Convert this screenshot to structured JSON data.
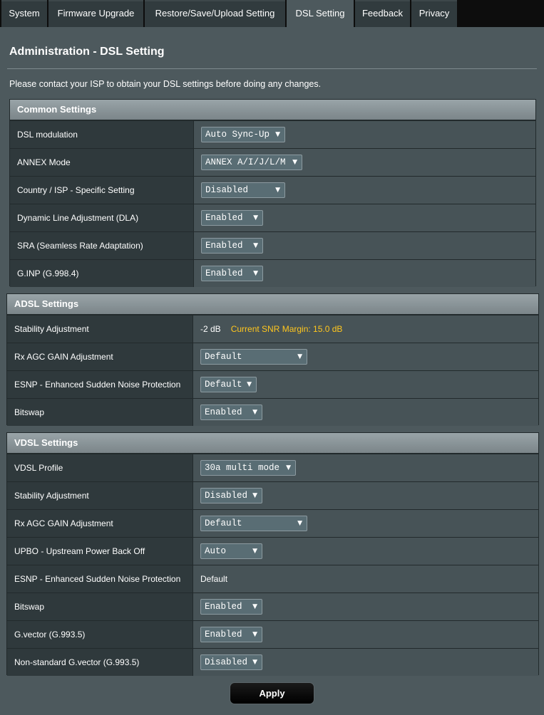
{
  "tabs": [
    "System",
    "Firmware Upgrade",
    "Restore/Save/Upload Setting",
    "DSL Setting",
    "Feedback",
    "Privacy"
  ],
  "active_tab": "DSL Setting",
  "page_title": "Administration - DSL Setting",
  "notice": "Please contact your ISP to obtain your DSL settings before doing any changes.",
  "common": {
    "title": "Common Settings",
    "rows": [
      {
        "label": "DSL modulation",
        "value": "Auto Sync-Up"
      },
      {
        "label": "ANNEX Mode",
        "value": "ANNEX A/I/J/L/M"
      },
      {
        "label": "Country / ISP - Specific Setting",
        "value": "Disabled"
      },
      {
        "label": "Dynamic Line Adjustment (DLA)",
        "value": "Enabled"
      },
      {
        "label": "SRA (Seamless Rate Adaptation)",
        "value": "Enabled"
      },
      {
        "label": "G.INP (G.998.4)",
        "value": "Enabled"
      }
    ]
  },
  "adsl": {
    "title": "ADSL Settings",
    "stability_label": "Stability Adjustment",
    "stability_value": "-2 dB",
    "snr_text": "Current SNR Margin: 15.0 dB",
    "rows": [
      {
        "label": "Rx AGC GAIN Adjustment",
        "value": "Default"
      },
      {
        "label": "ESNP - Enhanced Sudden Noise Protection",
        "value": "Default"
      },
      {
        "label": "Bitswap",
        "value": "Enabled"
      }
    ]
  },
  "vdsl": {
    "title": "VDSL Settings",
    "rows": [
      {
        "label": "VDSL Profile",
        "value": "30a multi mode"
      },
      {
        "label": "Stability Adjustment",
        "value": "Disabled"
      },
      {
        "label": "Rx AGC GAIN Adjustment",
        "value": "Default"
      },
      {
        "label": "UPBO - Upstream Power Back Off",
        "value": "Auto"
      }
    ],
    "esnp_label": "ESNP - Enhanced Sudden Noise Protection",
    "esnp_value": "Default",
    "rows2": [
      {
        "label": "Bitswap",
        "value": "Enabled"
      },
      {
        "label": "G.vector (G.993.5)",
        "value": "Enabled"
      },
      {
        "label": "Non-standard G.vector (G.993.5)",
        "value": "Disabled"
      }
    ]
  },
  "apply_label": "Apply",
  "colors": {
    "accent_snr": "#ffc61e",
    "background": "#4d595d"
  }
}
